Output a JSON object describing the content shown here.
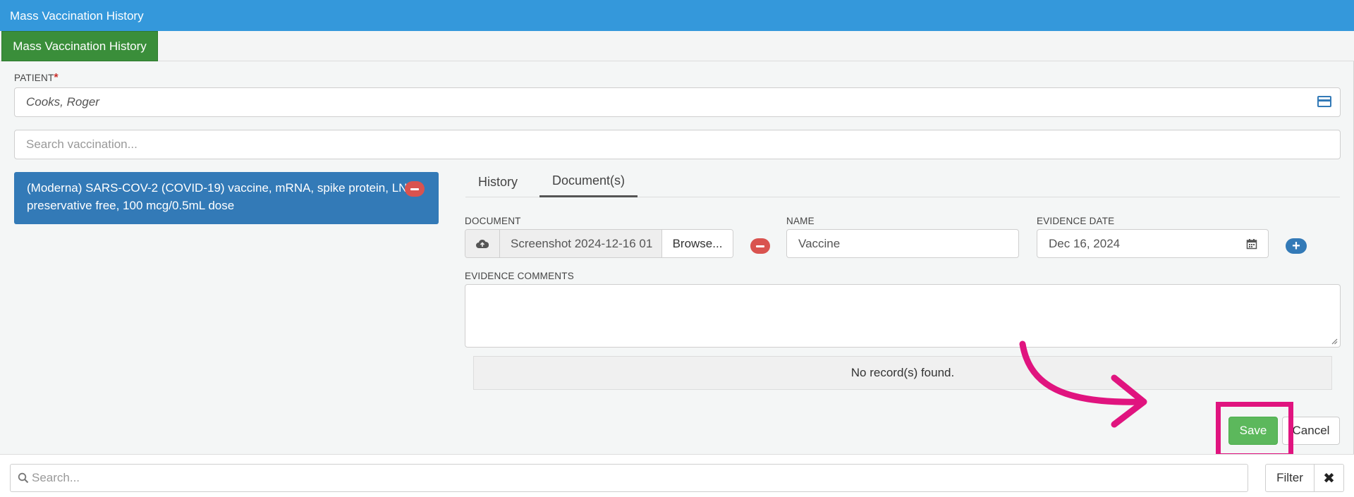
{
  "window": {
    "title": "Mass Vaccination History"
  },
  "tabstrip": {
    "active_tab": "Mass Vaccination History"
  },
  "patient": {
    "label": "PATIENT",
    "required_mark": "*",
    "value": "Cooks, Roger"
  },
  "vaccination_search": {
    "placeholder": "Search vaccination..."
  },
  "selected_vaccine": {
    "text": "(Moderna) SARS-COV-2 (COVID-19) vaccine, mRNA, spike protein, LNP, preservative free, 100 mcg/0.5mL dose"
  },
  "detail_tabs": [
    {
      "label": "History",
      "active": false
    },
    {
      "label": "Document(s)",
      "active": true
    }
  ],
  "document": {
    "label": "DOCUMENT",
    "file_name": "Screenshot 2024-12-16 01",
    "browse_label": "Browse..."
  },
  "name_field": {
    "label": "NAME",
    "value": "Vaccine"
  },
  "evidence_date": {
    "label": "EVIDENCE DATE",
    "value": "Dec 16, 2024"
  },
  "evidence_comments": {
    "label": "EVIDENCE COMMENTS",
    "value": ""
  },
  "records": {
    "empty_message": "No record(s) found."
  },
  "actions": {
    "save_label": "Save",
    "cancel_label": "Cancel"
  },
  "footer": {
    "search_placeholder": "Search...",
    "filter_label": "Filter",
    "clear_label": "✖"
  },
  "colors": {
    "titlebar": "#3498db",
    "active_tab": "#3a8e3a",
    "selected_item": "#337ab7",
    "save": "#5cb85c",
    "remove": "#d9534f",
    "annotation": "#e0147f"
  }
}
